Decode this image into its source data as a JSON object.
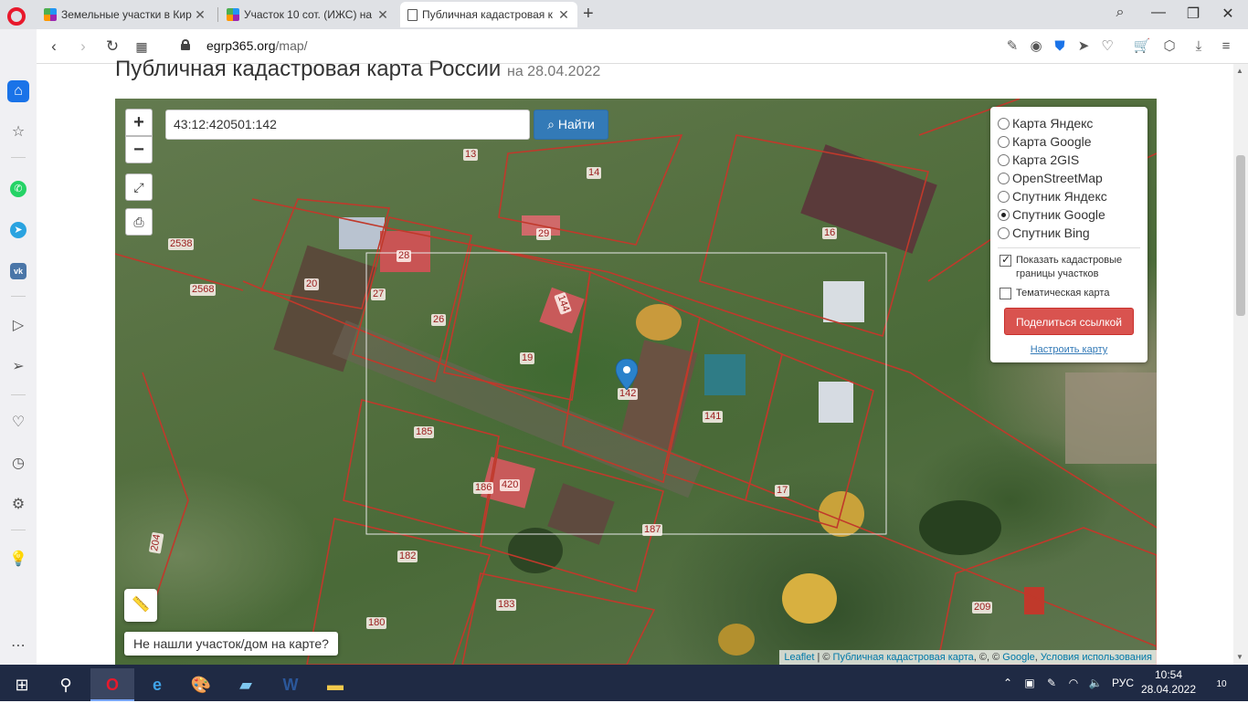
{
  "browser": {
    "tabs": [
      {
        "title": "Земельные участки в Кир",
        "active": false
      },
      {
        "title": "Участок 10 сот. (ИЖС) на",
        "active": false
      },
      {
        "title": "Публичная кадастровая к",
        "active": true
      }
    ],
    "url_domain": "egrp365.org",
    "url_path": "/map/"
  },
  "page": {
    "title": "Публичная кадастровая карта России",
    "date": "на 28.04.2022"
  },
  "map": {
    "search_value": "43:12:420501:142",
    "search_button": "Найти",
    "zoom_in": "+",
    "zoom_out": "−",
    "layers": [
      {
        "label": "Карта Яндекс",
        "selected": false
      },
      {
        "label": "Карта Google",
        "selected": false
      },
      {
        "label": "Карта 2GIS",
        "selected": false
      },
      {
        "label": "OpenStreetMap",
        "selected": false
      },
      {
        "label": "Спутник Яндекс",
        "selected": false
      },
      {
        "label": "Спутник Google",
        "selected": true
      },
      {
        "label": "Спутник Bing",
        "selected": false
      }
    ],
    "show_cadastral": "Показать кадастровые границы участков",
    "thematic": "Тематическая карта",
    "share_button": "Поделиться ссылкой",
    "config_link": "Настроить карту",
    "not_found_button": "Не нашли участок/дом на карте?",
    "attribution": {
      "leaflet": "Leaflet",
      "sep1": " | © ",
      "pkk": "Публичная кадастровая карта",
      "sep2": ", ©, © ",
      "google": "Google",
      "sep3": ", ",
      "terms": "Условия использования"
    },
    "parcel_labels": [
      "13",
      "14",
      "2538",
      "2568",
      "20",
      "28",
      "29",
      "27",
      "26",
      "16",
      "144",
      "19",
      "142",
      "141",
      "185",
      "186",
      "420",
      "17",
      "187",
      "204",
      "182",
      "183",
      "180",
      "209"
    ]
  },
  "taskbar": {
    "lang": "РУС",
    "time": "10:54",
    "date": "28.04.2022",
    "notifications": "10"
  },
  "colors": {
    "accent_blue": "#337ab7",
    "share_red": "#d9534f",
    "parcel_line": "#c0392b",
    "opera_red": "#e8192c"
  }
}
